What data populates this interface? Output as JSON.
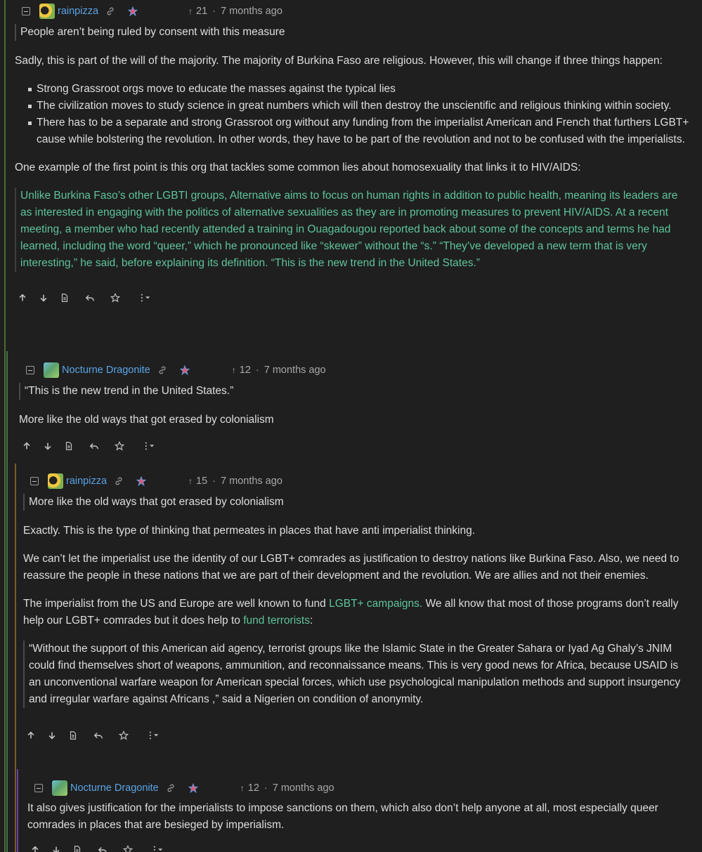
{
  "comments": [
    {
      "user": "rainpizza",
      "score": "21",
      "time": "7 months ago",
      "quote": "People aren’t being ruled by consent with this measure",
      "p1": "Sadly, this is part of the will of the majority. The majority of Burkina Faso are religious. However, this will change if three things happen:",
      "bullets": [
        "Strong Grassroot orgs move to educate the masses against the typical lies",
        "The civilization moves to study science in great numbers which will then destroy the unscientific and religious thinking within society.",
        "There has to be a separate and strong Grassroot org without any funding from the imperialist American and French that furthers LGBT+ cause while bolstering the revolution. In other words, they have to be part of the revolution and not to be confused with the imperialists."
      ],
      "p2": "One example of the first point is this org that tackles some common lies about homosexuality that links it to HIV/AIDS:",
      "green_quote": "Unlike Burkina Faso’s other LGBTI groups, Alternative aims to focus on human rights in addition to public health, meaning its leaders are as interested in engaging with the politics of alternative sexualities as they are in promoting measures to prevent HIV/AIDS. At a recent meeting, a member who had recently attended a training in Ouagadougou reported back about some of the concepts and terms he had learned, including the word “queer,” which he pronounced like “skewer” without the “s.” “They’ve developed a new term that is very interesting,” he said, before explaining its definition. “This is the new trend in the United States.”"
    },
    {
      "user": "Nocturne Dragonite",
      "score": "12",
      "time": "7 months ago",
      "quote": "“This is the new trend in the United States.”",
      "p1": "More like the old ways that got erased by colonialism"
    },
    {
      "user": "rainpizza",
      "score": "15",
      "time": "7 months ago",
      "quote": "More like the old ways that got erased by colonialism",
      "p1": "Exactly. This is the type of thinking that permeates in places that have anti imperialist thinking.",
      "p2": "We can’t let the imperialist use the identity of our LGBT+ comrades as justification to destroy nations like Burkina Faso. Also, we need to reassure the people in these nations that we are part of their development and the revolution. We are allies and not their enemies.",
      "p3_a": "The imperialist from the US and Europe are well known to fund ",
      "p3_link1": "LGBT+ campaigns.",
      "p3_b": " We all know that most of those programs don’t really help our LGBT+ comrades but it does help to ",
      "p3_link2": "fund terrorists",
      "p3_c": ":",
      "quote2": "“Without the support of this American aid agency, terrorist groups like the Islamic State in the Greater Sahara or Iyad Ag Ghaly’s JNIM could find themselves short of weapons, ammunition, and reconnaissance means. This is very good news for Africa, because USAID is an unconventional warfare weapon for American special forces, which use psychological manipulation methods and support insurgency and irregular warfare against Africans ,” said a Nigerien on condition of anonymity."
    },
    {
      "user": "Nocturne Dragonite",
      "score": "12",
      "time": "7 months ago",
      "p1": "It also gives justification for the imperialists to impose sanctions on them, which also don’t help anyone at all, most especially queer comrades in places that are besieged by imperialism."
    }
  ],
  "colors": {
    "link": "#5aa4e6",
    "quote_green": "#5ec49b",
    "thread_1": "#5a6b3a",
    "thread_2": "#3f7a4a",
    "thread_3": "#6b3fa0"
  },
  "separator": "·",
  "upvote_arrow": "↑"
}
